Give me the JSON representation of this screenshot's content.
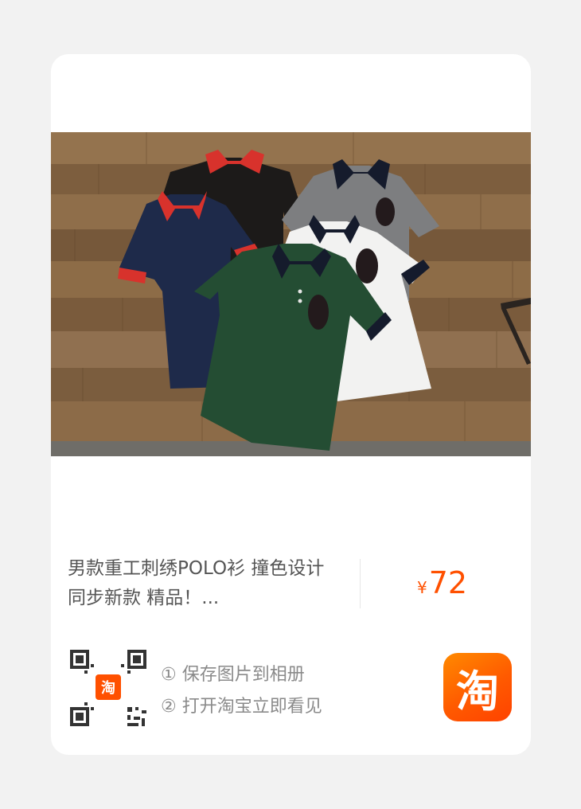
{
  "product": {
    "title": "男款重工刺绣POLO衫 撞色设计 同步新款 精品！...",
    "currency_symbol": "¥",
    "price": "72",
    "image_icon": "polo-shirts-photo"
  },
  "share": {
    "step1": "① 保存图片到相册",
    "step2": "② 打开淘宝立即看见",
    "qr_badge": "淘",
    "app_logo": "淘"
  },
  "colors": {
    "page_bg": "#f2f2f2",
    "card_bg": "#ffffff",
    "price": "#ff5000",
    "title": "#555555",
    "steps": "#8a8a8a",
    "brand": "#ff5000"
  }
}
